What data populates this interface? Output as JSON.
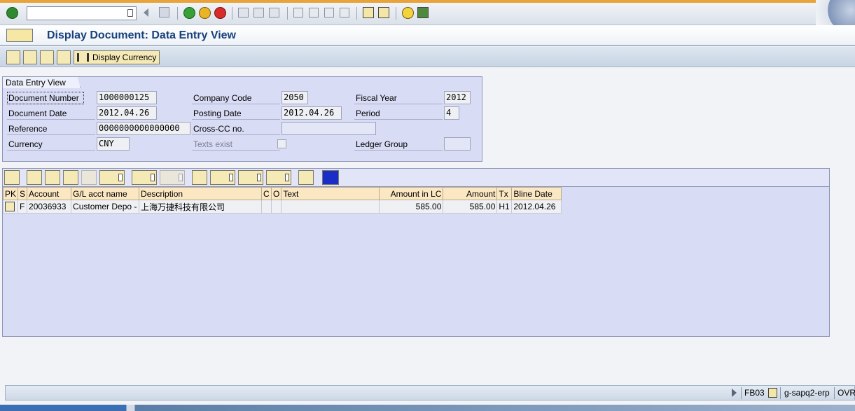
{
  "systoolbar": {
    "command_field_value": "",
    "icons": [
      "enter-icon",
      "back-icon",
      "save-icon",
      "back-green-icon",
      "exit-icon",
      "cancel-icon",
      "print-icon",
      "find-icon",
      "find-next-icon",
      "first-page-icon",
      "previous-page-icon",
      "next-page-icon",
      "last-page-icon",
      "new-session-icon",
      "shortcut-icon",
      "help-icon",
      "layout-icon"
    ]
  },
  "titlebar": {
    "title": "Display Document: Data Entry View"
  },
  "apptoolbar": {
    "display_currency_label": "Display Currency"
  },
  "header_group": {
    "tab_label": "Data Entry View",
    "document_number_label": "Document Number",
    "document_number_value": "1000000125",
    "company_code_label": "Company Code",
    "company_code_value": "2050",
    "fiscal_year_label": "Fiscal Year",
    "fiscal_year_value": "2012",
    "document_date_label": "Document Date",
    "document_date_value": "2012.04.26",
    "posting_date_label": "Posting Date",
    "posting_date_value": "2012.04.26",
    "period_label": "Period",
    "period_value": "4",
    "reference_label": "Reference",
    "reference_value": "0000000000000000",
    "cross_cc_label": "Cross-CC no.",
    "cross_cc_value": "",
    "currency_label": "Currency",
    "currency_value": "CNY",
    "texts_exist_label": "Texts exist",
    "ledger_group_label": "Ledger Group",
    "ledger_group_value": ""
  },
  "grid": {
    "columns": [
      "PK",
      "S",
      "Account",
      "G/L acct name",
      "Description",
      "C",
      "O",
      "Text",
      "Amount in LC",
      "Amount",
      "Tx",
      "Bline Date"
    ],
    "rows": [
      {
        "pk": "",
        "s": "F",
        "account": "20036933",
        "gl_name": "Customer Depo -",
        "description": "上海万捷科技有限公司",
        "c": "",
        "o": "",
        "text": "",
        "amount_lc": "585.00",
        "amount": "585.00",
        "tx": "H1",
        "bline_date": "2012.04.26"
      }
    ]
  },
  "statusbar": {
    "tcode": "FB03",
    "server": "g-sapq2-erp",
    "mode": "OVR"
  }
}
